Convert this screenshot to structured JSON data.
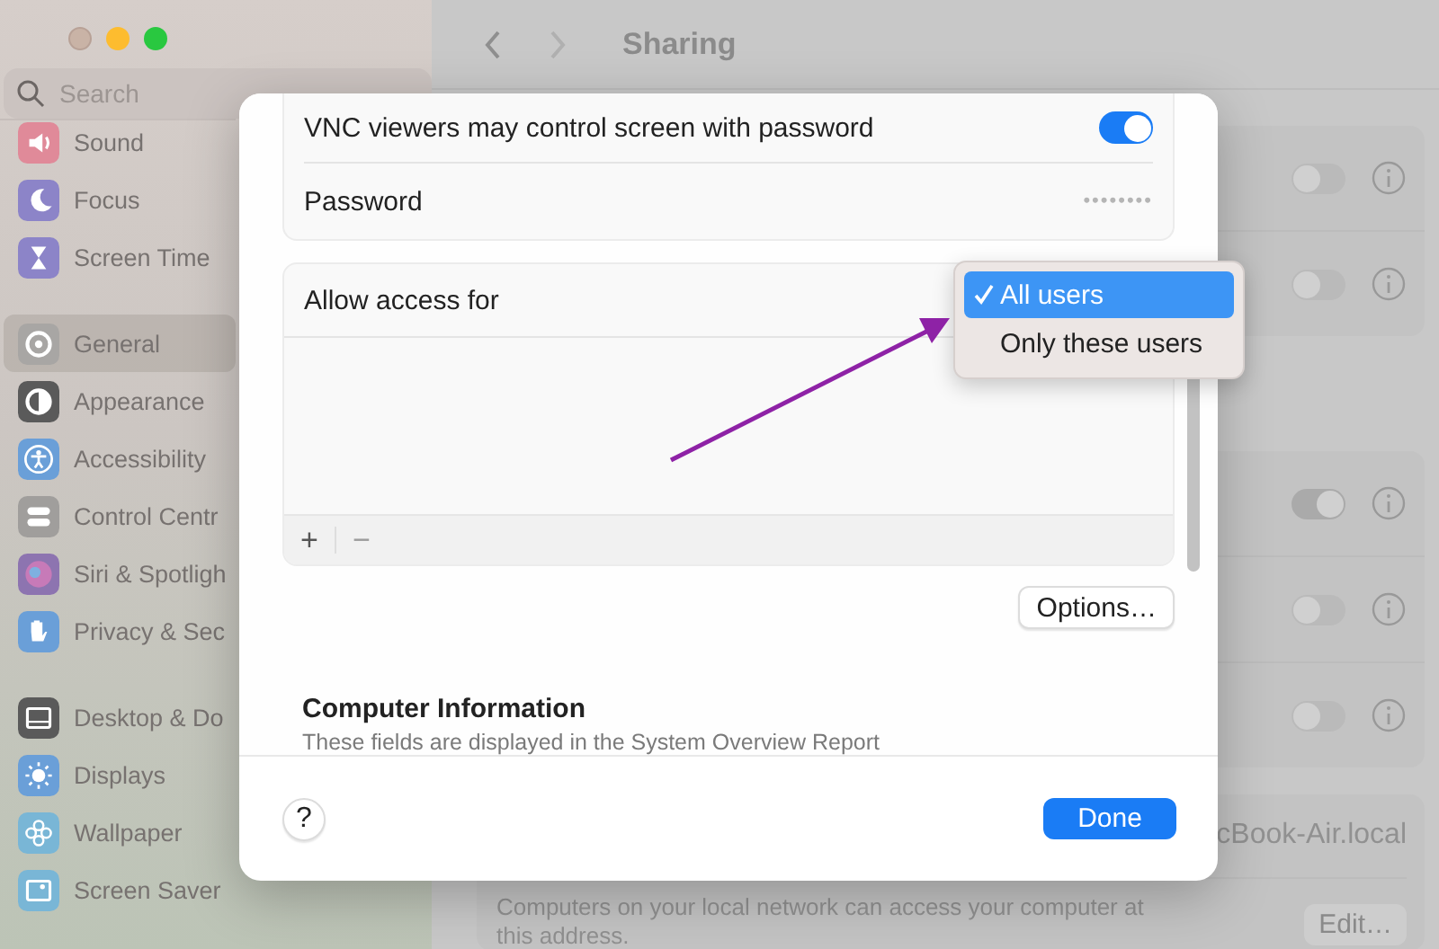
{
  "sidebar": {
    "search": {
      "placeholder": "Search"
    },
    "sections": [
      {
        "items": [
          {
            "label": "Sound",
            "color": "#e08a99",
            "selected": false
          },
          {
            "label": "Focus",
            "color": "#8c84c8",
            "selected": false
          },
          {
            "label": "Screen Time",
            "color": "#8c84c8",
            "selected": false
          }
        ]
      },
      {
        "items": [
          {
            "label": "General",
            "color": "#a8a6a4",
            "selected": true
          },
          {
            "label": "Appearance",
            "color": "#5a5a5a",
            "selected": false
          },
          {
            "label": "Accessibility",
            "color": "#6a9fd8",
            "selected": false
          },
          {
            "label": "Control Centr",
            "color": "#a09e9c",
            "selected": false
          },
          {
            "label": "Siri & Spotligh",
            "color": "#8d74b0",
            "selected": false
          },
          {
            "label": "Privacy & Sec",
            "color": "#6a9fd8",
            "selected": false
          }
        ]
      },
      {
        "items": [
          {
            "label": "Desktop & Do",
            "color": "#5a5a5a",
            "selected": false
          },
          {
            "label": "Displays",
            "color": "#6a9fd8",
            "selected": false
          },
          {
            "label": "Wallpaper",
            "color": "#79b6d6",
            "selected": false
          },
          {
            "label": "Screen Saver",
            "color": "#79b6d6",
            "selected": false
          }
        ]
      }
    ]
  },
  "toolbar": {
    "title": "Sharing"
  },
  "service_groups": [
    {
      "rows": [
        {
          "on": false
        },
        {
          "on": false
        }
      ]
    },
    {
      "rows": [
        {
          "on": true
        },
        {
          "on": false
        },
        {
          "on": false
        }
      ]
    }
  ],
  "hostname": {
    "value": "cBook-Air.local",
    "note": "Computers on your local network can access your computer at this address.",
    "button": "Edit…"
  },
  "sheet": {
    "vnc": {
      "label": "VNC viewers may control screen with password",
      "on": true
    },
    "password": {
      "label": "Password",
      "value": "••••••••"
    },
    "access": {
      "label": "Allow access for",
      "menu": [
        {
          "label": "All users",
          "selected": true
        },
        {
          "label": "Only these users",
          "selected": false
        }
      ],
      "list_buttons": [
        {
          "label": "+",
          "disabled": false
        },
        {
          "label": "−",
          "disabled": true
        }
      ]
    },
    "options_button": "Options…",
    "info": {
      "title": "Computer Information",
      "subtitle": "These fields are displayed in the System Overview Report"
    },
    "help_button": "?",
    "done_button": "Done"
  }
}
